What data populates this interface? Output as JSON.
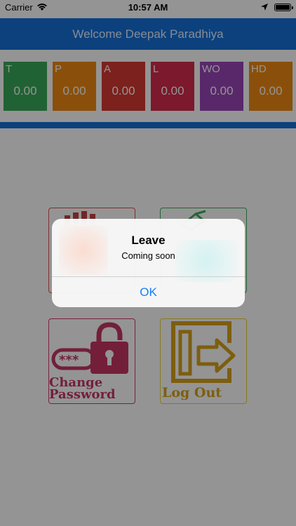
{
  "status_bar": {
    "carrier": "Carrier",
    "time": "10:57 AM"
  },
  "header": {
    "title": "Welcome Deepak Paradhiya"
  },
  "stats": [
    {
      "label": "T",
      "value": "0.00",
      "color": "#3aa95a"
    },
    {
      "label": "P",
      "value": "0.00",
      "color": "#ee8a14"
    },
    {
      "label": "A",
      "value": "0.00",
      "color": "#d63a33"
    },
    {
      "label": "L",
      "value": "0.00",
      "color": "#d62c4c"
    },
    {
      "label": "WO",
      "value": "0.00",
      "color": "#9a45b8"
    },
    {
      "label": "HD",
      "value": "0.00",
      "color": "#ee8a14"
    }
  ],
  "menu": {
    "change_password": {
      "line1": "Change",
      "line2": "Password"
    },
    "logout": {
      "label": "Log Out"
    }
  },
  "alert": {
    "title": "Leave",
    "message": "Coming soon",
    "button": "OK"
  },
  "colors": {
    "primary": "#1670d9",
    "alert_button": "#147efb"
  }
}
